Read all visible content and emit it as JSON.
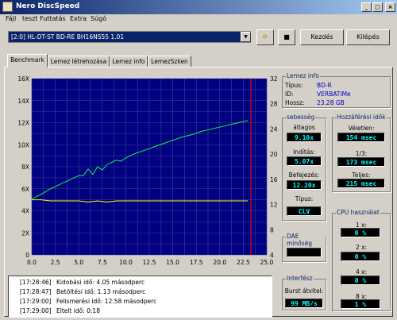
{
  "window": {
    "title": "Nero DiscSpeed"
  },
  "menu": [
    "Fájl",
    "teszt Futtatás",
    "Extra",
    "Súgó"
  ],
  "toolbar": {
    "drive": "[2:0]  HL-DT-ST BD-RE  BH16NS55 1.01",
    "start_label": "Kezdés",
    "exit_label": "Kilépés"
  },
  "tabs": [
    "Benchmark",
    "Lemez létrehozása",
    "Lemez info",
    "LemezSzken"
  ],
  "disc_info": {
    "title": "Lemez info",
    "type_label": "Típus:",
    "type_value": "BD-R",
    "id_label": "ID:",
    "id_value": "VERBATIMe",
    "capacity_label": "Hossz:",
    "capacity_value": "23.28 GB"
  },
  "speed": {
    "title": "sebesség",
    "average_label": "átlagos",
    "average_value": "9.10x",
    "start_label": "Indítás:",
    "start_value": "5.07x",
    "end_label": "Befejezés:",
    "end_value": "12.20x",
    "type_label": "Típus:",
    "type_value": "CLV"
  },
  "access": {
    "title": "Hozzáférési idők",
    "random_label": "Véletlen:",
    "random_value": "154 msec",
    "third_label": "1/3:",
    "third_value": "173 msec",
    "full_label": "Teljes:",
    "full_value": "215 msec"
  },
  "cpu": {
    "title": "CPU használat",
    "items": [
      {
        "label": "1 x:",
        "value": "0 %"
      },
      {
        "label": "2 x:",
        "value": "0 %"
      },
      {
        "label": "4 x:",
        "value": "0 %"
      },
      {
        "label": "8 x:",
        "value": "1 %"
      }
    ]
  },
  "dae": {
    "title": "DAE minőség",
    "value": ""
  },
  "interface": {
    "title": "Interfész",
    "burst_label": "Burst átvitel:",
    "burst_value": "99 MB/s"
  },
  "log": [
    {
      "time": "[17:28:46]",
      "msg": "Kidobási idő: 4.05 másodperc"
    },
    {
      "time": "[17:28:47]",
      "msg": "Betöltési idő: 1.13 másodperc"
    },
    {
      "time": "[17:29:00]",
      "msg": "Felismerési idő: 12.58 másodperc"
    },
    {
      "time": "[17:29:00]",
      "msg": "Eltelt idő:  0:18"
    }
  ],
  "colors": {
    "plot_bg": "#000080",
    "grid": "#4040a0",
    "speed": "#00ff40",
    "rpm": "#ffff00",
    "marker": "#ff0000"
  },
  "chart_data": {
    "type": "line",
    "title": "",
    "xlabel": "",
    "ylabel": "",
    "xlim": [
      0,
      25
    ],
    "ylim": [
      0,
      16
    ],
    "y2lim": [
      4,
      32
    ],
    "x_ticks": [
      "0.0",
      "2.5",
      "5.0",
      "7.5",
      "10.0",
      "12.5",
      "15.0",
      "17.5",
      "20.0",
      "22.5",
      "25.0"
    ],
    "y_ticks": [
      "0",
      "2X",
      "4X",
      "6X",
      "8X",
      "10X",
      "12X",
      "14X",
      "16X"
    ],
    "y2_ticks": [
      "4",
      "8",
      "12",
      "16",
      "20",
      "24",
      "28",
      "32"
    ],
    "end_marker_x": 23.3,
    "series": [
      {
        "values_x": [
          0,
          1,
          2,
          3,
          4,
          5,
          5.5,
          6,
          6.5,
          7,
          7.5,
          8,
          8.5,
          9,
          9.5,
          10,
          11,
          12,
          13,
          14,
          15,
          16,
          17,
          18,
          19,
          20,
          21,
          22,
          23
        ],
        "values_y": [
          5.07,
          5.5,
          6.0,
          6.4,
          6.8,
          7.2,
          7.2,
          7.8,
          7.3,
          8.0,
          7.7,
          8.2,
          8.4,
          8.6,
          8.5,
          8.8,
          9.2,
          9.5,
          9.8,
          10.1,
          10.4,
          10.7,
          10.9,
          11.2,
          11.4,
          11.6,
          11.8,
          12.0,
          12.2
        ]
      },
      {
        "values_x": [
          0,
          1,
          2,
          3,
          4,
          5,
          6,
          7,
          8,
          9,
          10,
          12,
          14,
          16,
          18,
          20,
          22,
          23
        ],
        "values_y": [
          5.0,
          5.0,
          4.9,
          4.9,
          4.9,
          4.9,
          4.8,
          4.9,
          4.8,
          4.9,
          4.9,
          4.9,
          4.9,
          4.9,
          4.9,
          4.9,
          4.9,
          4.9
        ]
      }
    ]
  }
}
